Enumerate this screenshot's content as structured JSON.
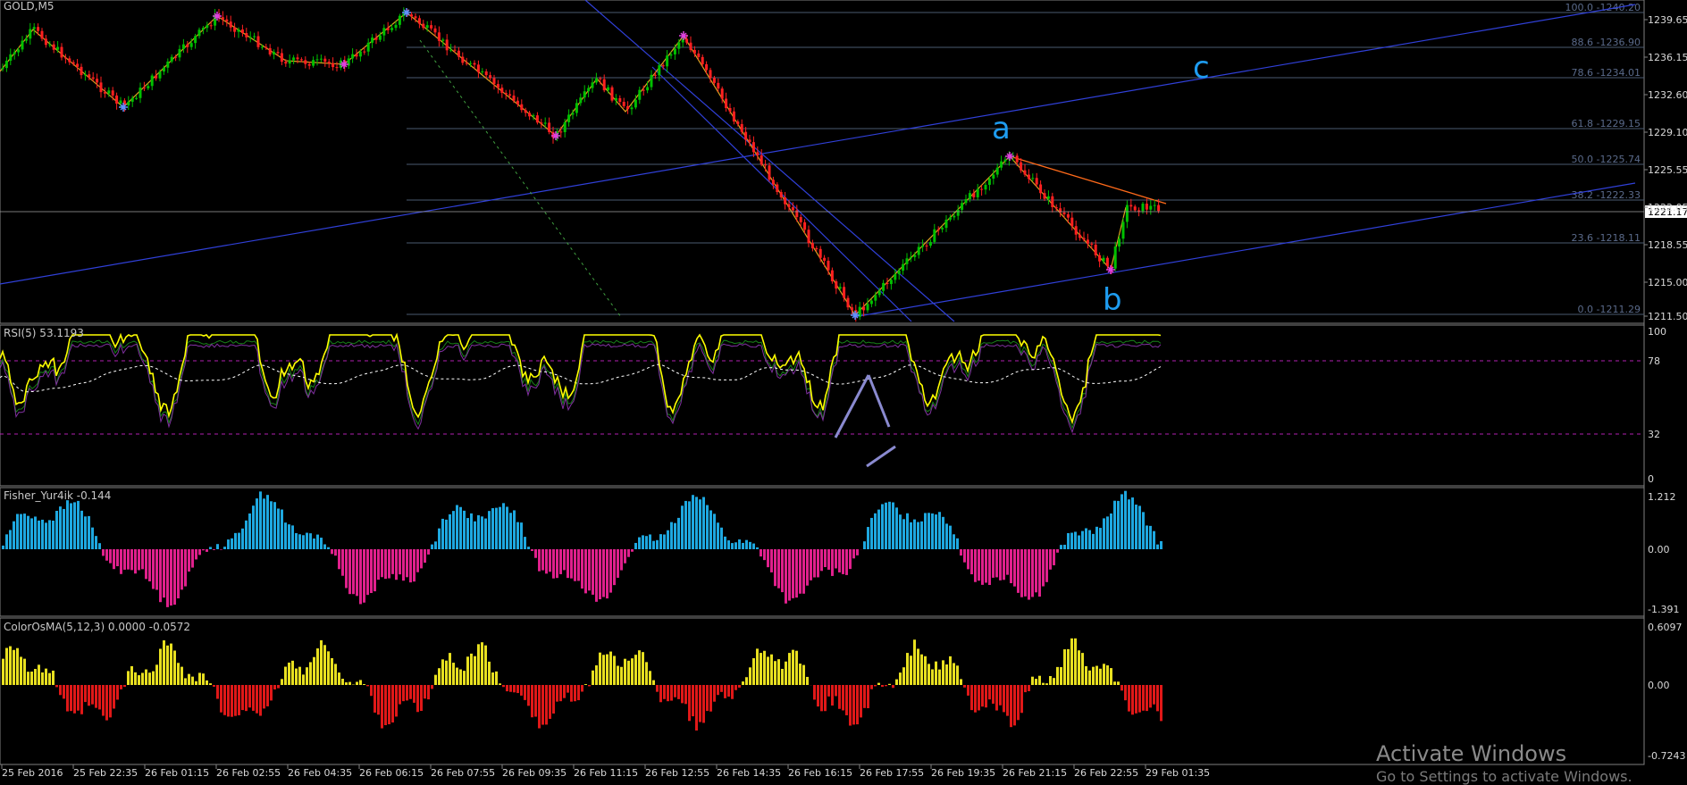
{
  "symbol": "GOLD,M5",
  "price_axis": {
    "labels": [
      "1239.65",
      "1236.15",
      "1232.60",
      "1229.10",
      "1225.55",
      "1222.05",
      "1218.55",
      "1215.00",
      "1211.50"
    ],
    "current_price": "1221.17"
  },
  "fibonacci": [
    "100.0 -1240.20",
    "88.6 -1236.90",
    "78.6 -1234.01",
    "61.8 -1229.15",
    "50.0 -1225.74",
    "38.2 -1222.33",
    "23.6 -1218.11",
    "0.0 -1211.29"
  ],
  "waves": {
    "a": "a",
    "b": "b",
    "c": "c"
  },
  "rsi": {
    "title": "RSI(5) 53.1193",
    "levels": [
      "100",
      "78",
      "32",
      "0"
    ]
  },
  "fisher": {
    "title": "Fisher_Yur4ik -0.144",
    "levels": [
      "1.212",
      "0.00",
      "-1.391"
    ]
  },
  "osma": {
    "title": "ColorOsMA(5,12,3) 0.0000 -0.0572",
    "levels": [
      "0.6097",
      "0.00",
      "-0.7243"
    ]
  },
  "time_axis": [
    "25 Feb 2016",
    "25 Feb 22:35",
    "26 Feb 01:15",
    "26 Feb 02:55",
    "26 Feb 04:35",
    "26 Feb 06:15",
    "26 Feb 07:55",
    "26 Feb 09:35",
    "26 Feb 11:15",
    "26 Feb 12:55",
    "26 Feb 14:35",
    "26 Feb 16:15",
    "26 Feb 17:55",
    "26 Feb 19:35",
    "26 Feb 21:15",
    "26 Feb 22:55",
    "29 Feb 01:35"
  ],
  "watermark": {
    "line1": "Activate Windows",
    "line2": "Go to Settings to activate Windows."
  },
  "colors": {
    "bull": "#00c000",
    "bear": "#ff2020",
    "rsi": "#ffff00",
    "fisher_pos": "#1ea8e0",
    "fisher_neg": "#e0208c",
    "osma_pos": "#e8e020",
    "osma_neg": "#e01818",
    "wave": "#1e9cf0",
    "grid": "#4a5a70"
  }
}
